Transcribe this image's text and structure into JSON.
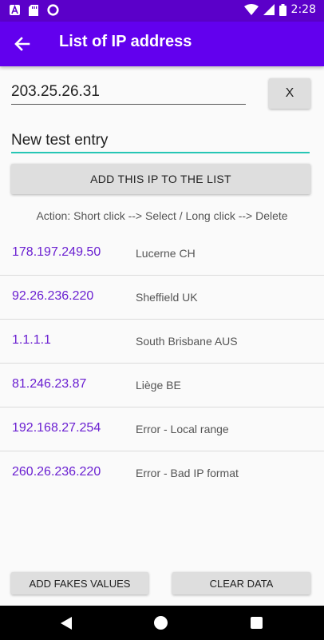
{
  "status_bar": {
    "time": "2:28"
  },
  "app_bar": {
    "title": "List of IP address"
  },
  "form": {
    "ip_value": "203.25.26.31",
    "clear_label": "X",
    "label_value": "New test entry",
    "add_label": "ADD THIS IP TO THE LIST"
  },
  "hint": "Action: Short click --> Select / Long click --> Delete",
  "entries": [
    {
      "ip": "178.197.249.50",
      "location": "Lucerne CH"
    },
    {
      "ip": "92.26.236.220",
      "location": "Sheffield UK"
    },
    {
      "ip": "1.1.1.1",
      "location": "South Brisbane AUS"
    },
    {
      "ip": "81.246.23.87",
      "location": "Liège BE"
    },
    {
      "ip": "192.168.27.254",
      "location": "Error - Local range"
    },
    {
      "ip": "260.26.236.220",
      "location": "Error - Bad IP format"
    }
  ],
  "bottom": {
    "fakes_label": "ADD FAKES VALUES",
    "clear_label": "CLEAR DATA"
  },
  "colors": {
    "primary": "#6200ee",
    "status_bar": "#5b00c9",
    "ip_text": "#6a1fd1",
    "accent": "#26c6b5"
  }
}
